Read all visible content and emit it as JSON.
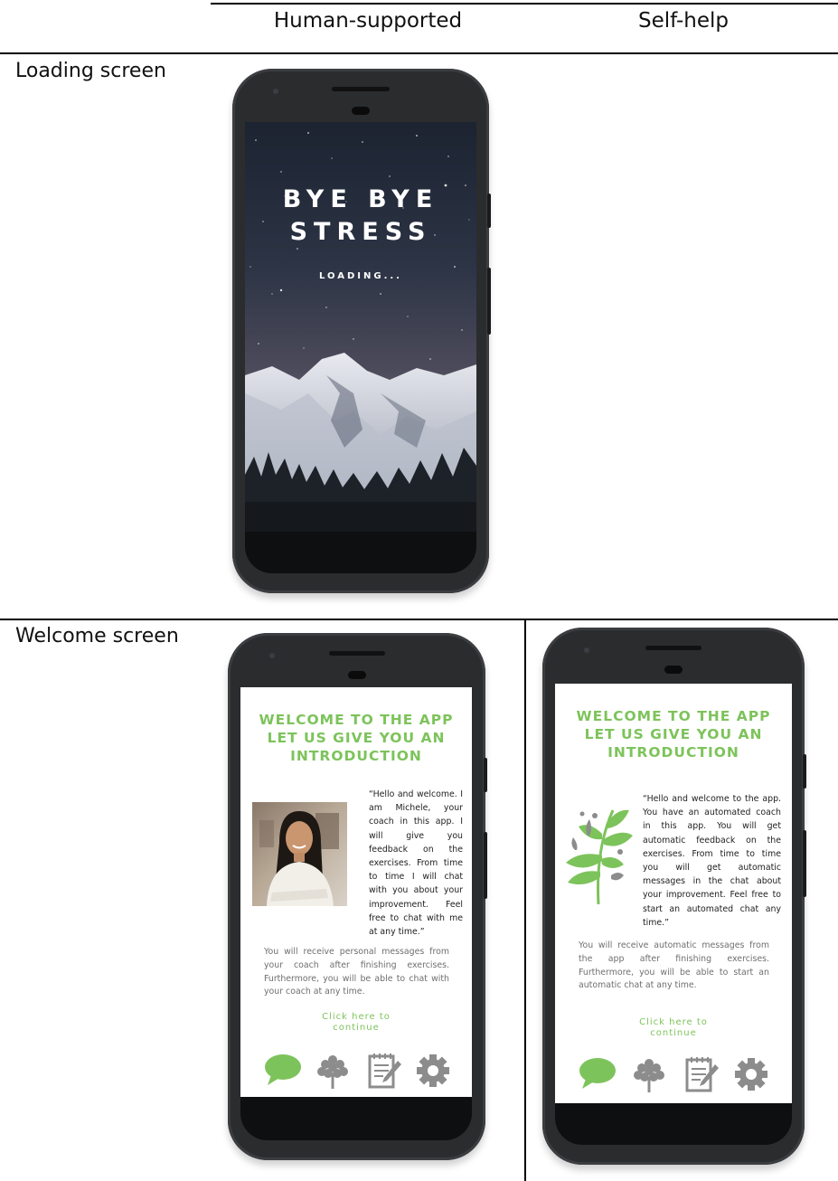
{
  "table": {
    "columns": [
      "Human-supported",
      "Self-help"
    ],
    "rows": [
      "Loading screen",
      "Welcome screen"
    ]
  },
  "loading": {
    "title_line1": "BYE BYE",
    "title_line2": "STRESS",
    "subtitle": "LOADING..."
  },
  "welcome_human": {
    "title_line1": "WELCOME TO THE APP",
    "title_line2": "LET US GIVE YOU AN",
    "title_line3": "INTRODUCTION",
    "quote": "“Hello and welcome. I am Michele, your coach in this app. I will give you feedback on the exercises. From time to time I will chat with you about your improvement. Feel free to chat with me at any time.”",
    "info": "You will receive personal messages from your coach after finishing exercises. Furthermore, you will be able to chat with your coach at any time.",
    "cta_line1": "Click here to",
    "cta_line2": "continue"
  },
  "welcome_self": {
    "title_line1": "WELCOME TO THE APP",
    "title_line2": "LET US GIVE YOU AN",
    "title_line3": "INTRODUCTION",
    "quote": "“Hello and welcome to the app. You have an automated coach in this app. You will get automatic feedback on the exercises. From time to time you will get automatic messages in the chat about your improvement. Feel free to start an automated chat any time.”",
    "info": "You will receive automatic messages from the app after finishing exercises. Furthermore, you will be able to start an automatic chat at any time.",
    "cta_line1": "Click here to",
    "cta_line2": "continue"
  },
  "nav_icons": [
    "chat-bubble-icon",
    "tree-icon",
    "notepad-icon",
    "gear-icon"
  ],
  "colors": {
    "accent": "#7dc35b",
    "phone_body": "#2a2c2e",
    "icon_grey": "#8c8c8c"
  }
}
